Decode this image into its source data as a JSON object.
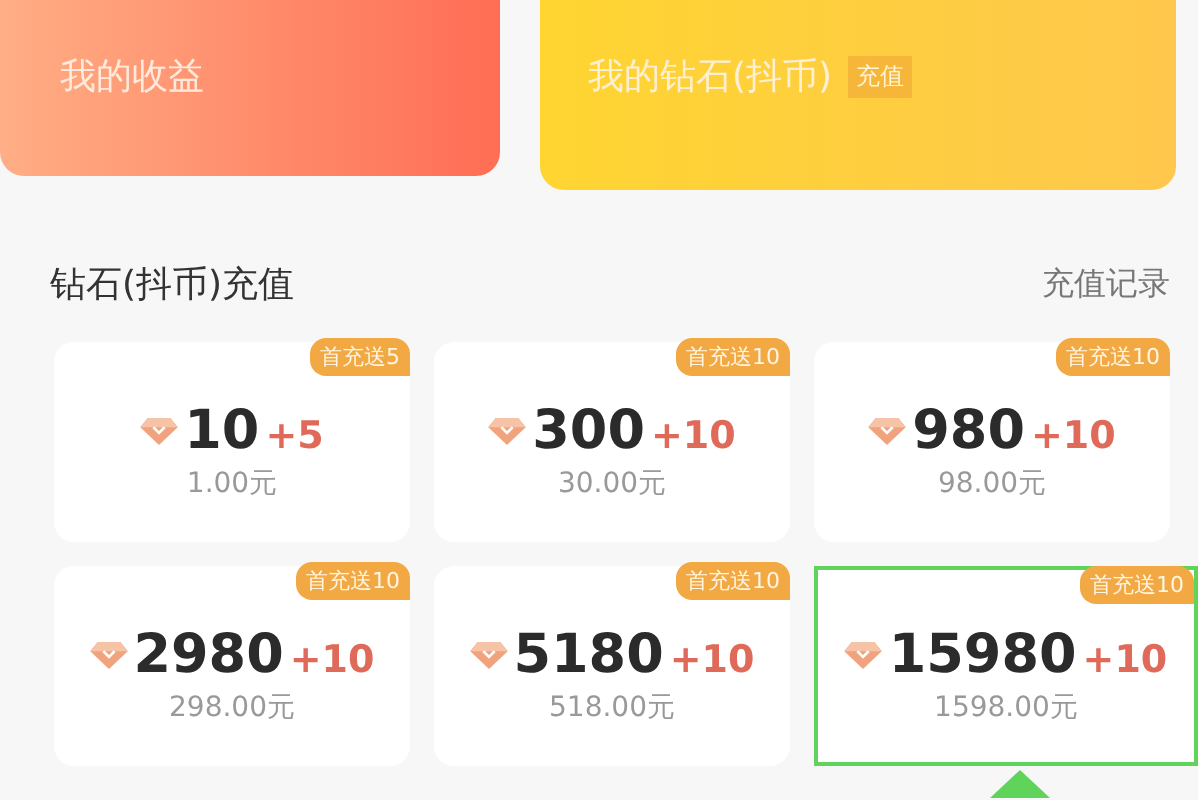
{
  "summary_cards": [
    {
      "kind": "earnings",
      "label": "我的收益"
    },
    {
      "kind": "diamonds",
      "label": "我的钻石(抖币)",
      "badge": "充值"
    }
  ],
  "section": {
    "title": "钻石(抖币)充值",
    "link": "充值记录"
  },
  "packages": [
    {
      "badge": "首充送5",
      "amount": "10",
      "bonus": "+5",
      "price": "1.00元",
      "selected": false
    },
    {
      "badge": "首充送10",
      "amount": "300",
      "bonus": "+10",
      "price": "30.00元",
      "selected": false
    },
    {
      "badge": "首充送10",
      "amount": "980",
      "bonus": "+10",
      "price": "98.00元",
      "selected": false
    },
    {
      "badge": "首充送10",
      "amount": "2980",
      "bonus": "+10",
      "price": "298.00元",
      "selected": false
    },
    {
      "badge": "首充送10",
      "amount": "5180",
      "bonus": "+10",
      "price": "518.00元",
      "selected": false
    },
    {
      "badge": "首充送10",
      "amount": "15980",
      "bonus": "+10",
      "price": "1598.00元",
      "selected": true
    }
  ]
}
